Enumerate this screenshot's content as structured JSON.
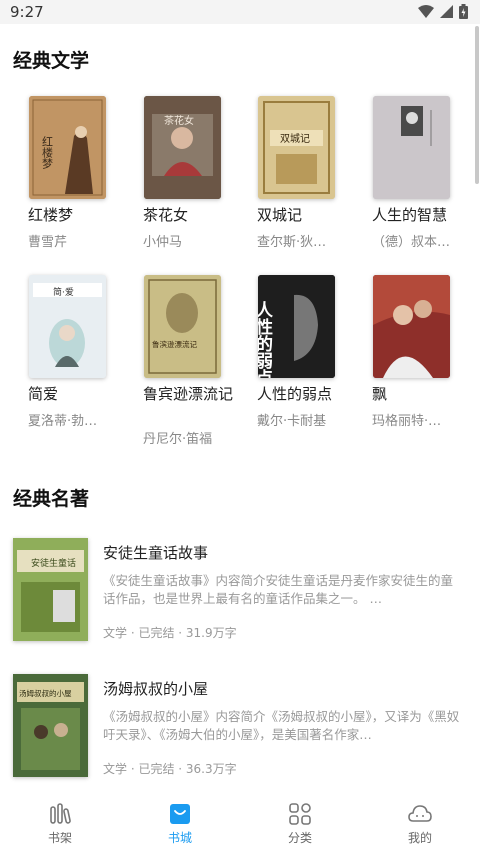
{
  "status": {
    "time": "9:27"
  },
  "sections": {
    "classic_lit": {
      "title": "经典文学"
    },
    "classic_works": {
      "title": "经典名著"
    }
  },
  "grid_books": [
    {
      "title": "红楼梦",
      "author": "曹雪芹"
    },
    {
      "title": "茶花女",
      "author": "小仲马"
    },
    {
      "title": "双城记",
      "author": "查尔斯·狄…"
    },
    {
      "title": "人生的智慧",
      "author": "（德）叔本…"
    },
    {
      "title": "简爱",
      "author": "夏洛蒂·勃…"
    },
    {
      "title": "鲁宾逊漂流记",
      "author": "丹尼尔·笛福"
    },
    {
      "title": "人性的弱点",
      "author": "戴尔·卡耐基"
    },
    {
      "title": "飘",
      "author": "玛格丽特·…"
    }
  ],
  "cover_text": {
    "hlm": "红楼梦",
    "chn": "茶花女",
    "scj": "双城记",
    "rxd": "人性的弱点",
    "jane": "简·爱",
    "lbx": "鲁滨逊漂流记",
    "ats": "安徒生童话",
    "tm": "汤姆叔叔的小屋"
  },
  "list_books": [
    {
      "title": "安徒生童话故事",
      "desc": "《安徒生童话故事》内容简介安徒生童话是丹麦作家安徒生的童话作品，也是世界上最有名的童话作品集之一。 …",
      "meta": "文学 · 已完结 · 31.9万字"
    },
    {
      "title": "汤姆叔叔的小屋",
      "desc": "《汤姆叔叔的小屋》内容简介《汤姆叔叔的小屋》，又译为《黑奴吁天录》、《汤姆大伯的小屋》，是美国著名作家…",
      "meta": "文学 · 已完结 · 36.3万字"
    }
  ],
  "nav": [
    {
      "label": "书架",
      "icon": "bookshelf-icon"
    },
    {
      "label": "书城",
      "icon": "bookstore-icon",
      "active": true
    },
    {
      "label": "分类",
      "icon": "category-icon"
    },
    {
      "label": "我的",
      "icon": "profile-icon"
    }
  ],
  "colors": {
    "accent": "#1a9bf0"
  }
}
